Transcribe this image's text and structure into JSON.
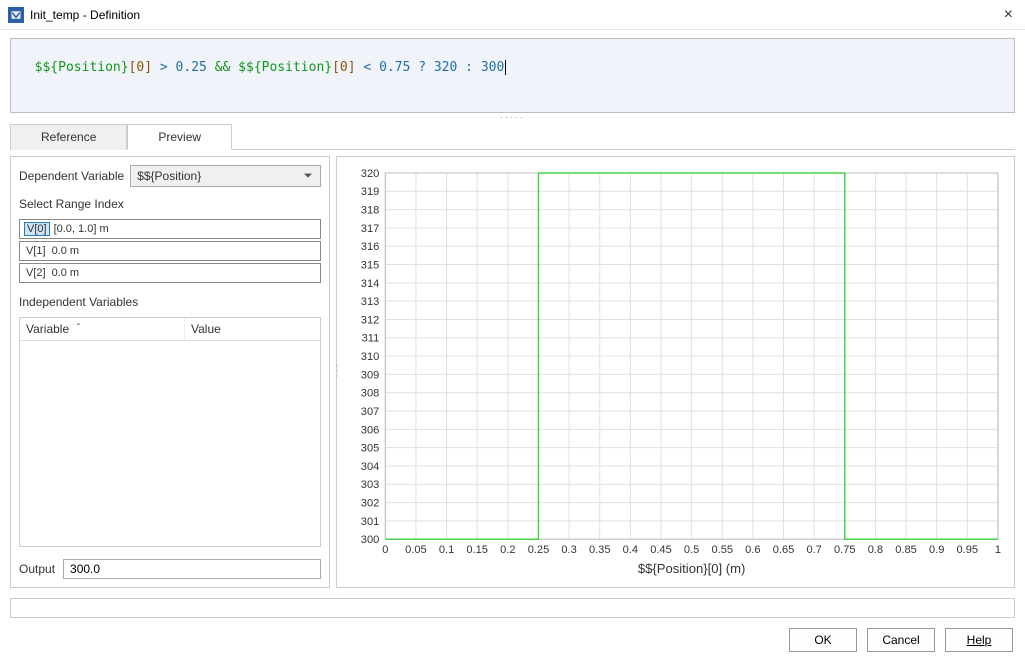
{
  "window": {
    "title": "Init_temp - Definition"
  },
  "code": {
    "tokens": [
      {
        "t": "var",
        "v": "$${Position}"
      },
      {
        "t": "idx",
        "v": "[0]"
      },
      {
        "t": "txt",
        "v": " "
      },
      {
        "t": "op",
        "v": ">"
      },
      {
        "t": "txt",
        "v": " "
      },
      {
        "t": "num",
        "v": "0.25"
      },
      {
        "t": "txt",
        "v": " "
      },
      {
        "t": "lg",
        "v": "&&"
      },
      {
        "t": "txt",
        "v": " "
      },
      {
        "t": "var",
        "v": "$${Position}"
      },
      {
        "t": "idx",
        "v": "[0]"
      },
      {
        "t": "txt",
        "v": " "
      },
      {
        "t": "op",
        "v": "<"
      },
      {
        "t": "txt",
        "v": " "
      },
      {
        "t": "num",
        "v": "0.75"
      },
      {
        "t": "txt",
        "v": " "
      },
      {
        "t": "op",
        "v": "?"
      },
      {
        "t": "txt",
        "v": " "
      },
      {
        "t": "num",
        "v": "320"
      },
      {
        "t": "txt",
        "v": " "
      },
      {
        "t": "op",
        "v": ":"
      },
      {
        "t": "txt",
        "v": " "
      },
      {
        "t": "num",
        "v": "300"
      }
    ]
  },
  "tabs": {
    "reference": "Reference",
    "preview": "Preview",
    "active": "preview"
  },
  "left": {
    "dep_var_label": "Dependent Variable",
    "dep_var_value": "$${Position}",
    "range_label": "Select Range Index",
    "ranges": [
      {
        "idx": "V[0]",
        "val": "[0.0, 1.0] m",
        "selected": true
      },
      {
        "idx": "V[1]",
        "val": "0.0 m",
        "selected": false
      },
      {
        "idx": "V[2]",
        "val": "0.0 m",
        "selected": false
      }
    ],
    "indep_label": "Independent Variables",
    "col_variable": "Variable",
    "col_value": "Value",
    "output_label": "Output",
    "output_value": "300.0"
  },
  "buttons": {
    "ok": "OK",
    "cancel": "Cancel",
    "help": "Help"
  },
  "chart_data": {
    "type": "line",
    "xlabel": "$${Position}[0] (m)",
    "ylabel": "",
    "xlim": [
      0,
      1
    ],
    "ylim": [
      300,
      320
    ],
    "xticks": [
      0,
      0.05,
      0.1,
      0.15,
      0.2,
      0.25,
      0.3,
      0.35,
      0.4,
      0.45,
      0.5,
      0.55,
      0.6,
      0.65,
      0.7,
      0.75,
      0.8,
      0.85,
      0.9,
      0.95,
      1
    ],
    "yticks": [
      300,
      301,
      302,
      303,
      304,
      305,
      306,
      307,
      308,
      309,
      310,
      311,
      312,
      313,
      314,
      315,
      316,
      317,
      318,
      319,
      320
    ],
    "series": [
      {
        "name": "Init_temp",
        "x": [
          0,
          0.25,
          0.25,
          0.75,
          0.75,
          1
        ],
        "y": [
          300,
          300,
          320,
          320,
          300,
          300
        ]
      }
    ]
  }
}
